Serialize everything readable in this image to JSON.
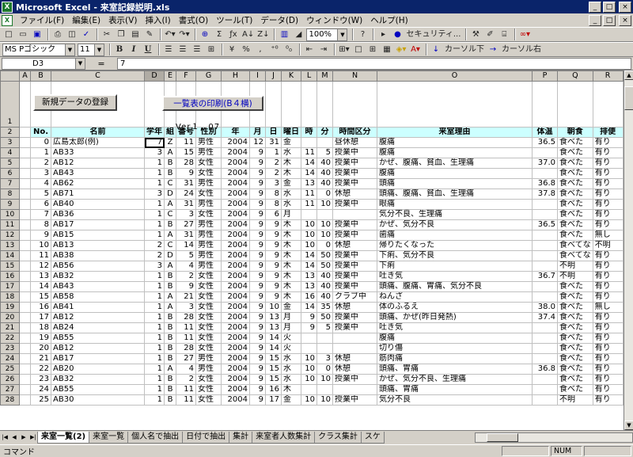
{
  "window": {
    "title": "Microsoft Excel - 来室記録説明.xls",
    "app_icon": "X",
    "min": "_",
    "max": "□",
    "close": "×"
  },
  "menu": {
    "items": [
      "ファイル(F)",
      "編集(E)",
      "表示(V)",
      "挿入(I)",
      "書式(O)",
      "ツール(T)",
      "データ(D)",
      "ウィンドウ(W)",
      "ヘルプ(H)"
    ],
    "doc_min": "_",
    "doc_max": "□",
    "doc_close": "×"
  },
  "toolbar": {
    "zoom": "100%",
    "help": "?",
    "security": "セキュリティ...",
    "font_name": "MS Pゴシック",
    "font_size": "11",
    "bold": "B",
    "italic": "I",
    "underline": "U",
    "percent": "%",
    "comma": ",",
    "cursor_down": "カーソル下",
    "cursor_right": "カーソル右"
  },
  "formula": {
    "cell": "D3",
    "eq": "=",
    "value": "7"
  },
  "columns": [
    "A",
    "B",
    "C",
    "D",
    "E",
    "F",
    "G",
    "H",
    "I",
    "J",
    "K",
    "L",
    "M",
    "N",
    "O",
    "P",
    "Q",
    "R"
  ],
  "sheet": {
    "btn_new": "新規データの登録",
    "btn_print": "一覧表の印刷(B４横)",
    "version": "Ver１．07",
    "headers": [
      "No.",
      "名前",
      "学年",
      "組",
      "番号",
      "性別",
      "年",
      "月",
      "日",
      "曜日",
      "時",
      "分",
      "時間区分",
      "来室理由",
      "体温",
      "朝食",
      "排便"
    ],
    "row_numbers": [
      "1",
      "2",
      "3",
      "4",
      "5",
      "6",
      "7",
      "8",
      "9",
      "10",
      "11",
      "12",
      "13",
      "14",
      "15",
      "16",
      "17",
      "18",
      "19",
      "20",
      "21",
      "22",
      "23",
      "24",
      "25",
      "26",
      "27",
      "28"
    ],
    "rows": [
      [
        "0",
        "広島太郎(例)",
        "7",
        "Z",
        "11",
        "男性",
        "2004",
        "12",
        "31",
        "金",
        "",
        "",
        "昼休憩",
        "腹痛",
        "36.5",
        "食べた",
        "有り"
      ],
      [
        "1",
        "AB33",
        "3",
        "A",
        "15",
        "男性",
        "2004",
        "9",
        "1",
        "水",
        "11",
        "5",
        "授業中",
        "腹痛",
        "",
        "食べた",
        "有り"
      ],
      [
        "2",
        "AB12",
        "1",
        "B",
        "28",
        "女性",
        "2004",
        "9",
        "2",
        "木",
        "14",
        "40",
        "授業中",
        "かぜ、腹痛、貧血、生理痛",
        "37.0",
        "食べた",
        "有り"
      ],
      [
        "3",
        "AB43",
        "1",
        "B",
        "9",
        "女性",
        "2004",
        "9",
        "2",
        "木",
        "14",
        "40",
        "授業中",
        "腹痛",
        "",
        "食べた",
        "有り"
      ],
      [
        "4",
        "AB62",
        "1",
        "C",
        "31",
        "男性",
        "2004",
        "9",
        "3",
        "金",
        "13",
        "40",
        "授業中",
        "頭痛",
        "36.8",
        "食べた",
        "有り"
      ],
      [
        "5",
        "AB71",
        "3",
        "D",
        "24",
        "女性",
        "2004",
        "9",
        "8",
        "水",
        "11",
        "0",
        "休憩",
        "頭痛、腹痛、貧血、生理痛",
        "37.8",
        "食べた",
        "有り"
      ],
      [
        "6",
        "AB40",
        "1",
        "A",
        "31",
        "男性",
        "2004",
        "9",
        "8",
        "水",
        "11",
        "10",
        "授業中",
        "眼痛",
        "",
        "食べた",
        "有り"
      ],
      [
        "7",
        "AB36",
        "1",
        "C",
        "3",
        "女性",
        "2004",
        "9",
        "6",
        "月",
        "",
        "",
        "",
        "気分不良、生理痛",
        "",
        "食べた",
        "有り"
      ],
      [
        "8",
        "AB17",
        "1",
        "B",
        "27",
        "男性",
        "2004",
        "9",
        "9",
        "木",
        "10",
        "10",
        "授業中",
        "かぜ、気分不良",
        "36.5",
        "食べた",
        "有り"
      ],
      [
        "9",
        "AB15",
        "1",
        "A",
        "31",
        "男性",
        "2004",
        "9",
        "9",
        "木",
        "10",
        "10",
        "授業中",
        "歯痛",
        "",
        "食べた",
        "無し"
      ],
      [
        "10",
        "AB13",
        "2",
        "C",
        "14",
        "男性",
        "2004",
        "9",
        "9",
        "木",
        "10",
        "0",
        "休憩",
        "帰りたくなった",
        "",
        "食べてな",
        "不明"
      ],
      [
        "11",
        "AB38",
        "2",
        "D",
        "5",
        "男性",
        "2004",
        "9",
        "9",
        "木",
        "14",
        "50",
        "授業中",
        "下痢、気分不良",
        "",
        "食べてな",
        "有り"
      ],
      [
        "12",
        "AB56",
        "3",
        "A",
        "4",
        "男性",
        "2004",
        "9",
        "9",
        "木",
        "14",
        "50",
        "授業中",
        "下痢",
        "",
        "不明",
        "有り"
      ],
      [
        "13",
        "AB32",
        "1",
        "B",
        "2",
        "女性",
        "2004",
        "9",
        "9",
        "木",
        "13",
        "40",
        "授業中",
        "吐き気",
        "36.7",
        "不明",
        "有り"
      ],
      [
        "14",
        "AB43",
        "1",
        "B",
        "9",
        "女性",
        "2004",
        "9",
        "9",
        "木",
        "13",
        "40",
        "授業中",
        "頭痛、腹痛、胃痛、気分不良",
        "",
        "食べた",
        "有り"
      ],
      [
        "15",
        "AB58",
        "1",
        "A",
        "21",
        "女性",
        "2004",
        "9",
        "9",
        "木",
        "16",
        "40",
        "クラブ中",
        "ねんざ",
        "",
        "食べた",
        "有り"
      ],
      [
        "16",
        "AB41",
        "1",
        "A",
        "3",
        "女性",
        "2004",
        "9",
        "10",
        "金",
        "14",
        "35",
        "休憩",
        "体のふるえ",
        "38.0",
        "食べた",
        "無し"
      ],
      [
        "17",
        "AB12",
        "1",
        "B",
        "28",
        "女性",
        "2004",
        "9",
        "13",
        "月",
        "9",
        "50",
        "授業中",
        "頭痛、かぜ(昨日発熱)",
        "37.4",
        "食べた",
        "有り"
      ],
      [
        "18",
        "AB24",
        "1",
        "B",
        "11",
        "女性",
        "2004",
        "9",
        "13",
        "月",
        "9",
        "5",
        "授業中",
        "吐き気",
        "",
        "食べた",
        "有り"
      ],
      [
        "19",
        "AB55",
        "1",
        "B",
        "11",
        "女性",
        "2004",
        "9",
        "14",
        "火",
        "",
        "",
        "",
        "腹痛",
        "",
        "食べた",
        "有り"
      ],
      [
        "20",
        "AB12",
        "1",
        "B",
        "28",
        "女性",
        "2004",
        "9",
        "14",
        "火",
        "",
        "",
        "",
        "切り傷",
        "",
        "食べた",
        "有り"
      ],
      [
        "21",
        "AB17",
        "1",
        "B",
        "27",
        "男性",
        "2004",
        "9",
        "15",
        "水",
        "10",
        "3",
        "休憩",
        "筋肉痛",
        "",
        "食べた",
        "有り"
      ],
      [
        "22",
        "AB20",
        "1",
        "A",
        "4",
        "男性",
        "2004",
        "9",
        "15",
        "水",
        "10",
        "0",
        "休憩",
        "頭痛、胃痛",
        "36.8",
        "食べた",
        "有り"
      ],
      [
        "23",
        "AB32",
        "1",
        "B",
        "2",
        "女性",
        "2004",
        "9",
        "15",
        "水",
        "10",
        "10",
        "授業中",
        "かぜ、気分不良、生理痛",
        "",
        "食べた",
        "有り"
      ],
      [
        "24",
        "AB55",
        "1",
        "B",
        "11",
        "女性",
        "2004",
        "9",
        "16",
        "木",
        "",
        "",
        "",
        "頭痛、胃痛",
        "",
        "食べた",
        "有り"
      ],
      [
        "25",
        "AB30",
        "1",
        "B",
        "11",
        "女性",
        "2004",
        "9",
        "17",
        "金",
        "10",
        "10",
        "授業中",
        "気分不良",
        "",
        "不明",
        "有り"
      ]
    ]
  },
  "tabs": [
    "来室一覧(2)",
    "来室一覧",
    "個人名で抽出",
    "日付で抽出",
    "集計",
    "来室者人数集計",
    "クラス集計",
    "スケ"
  ],
  "status": {
    "text": "コマンド",
    "num": "NUM"
  }
}
